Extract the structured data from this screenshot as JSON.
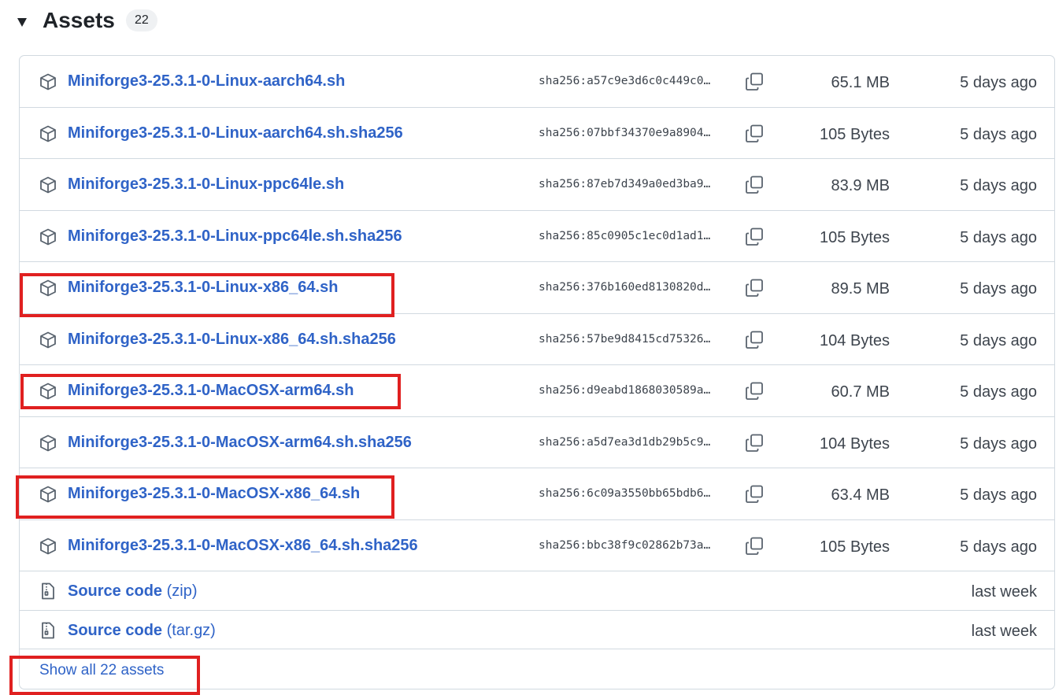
{
  "header": {
    "title": "Assets",
    "count": "22"
  },
  "assets": [
    {
      "name": "Miniforge3-25.3.1-0-Linux-aarch64.sh",
      "sha": "sha256:a57c9e3d6c0c449c0…",
      "size": "65.1 MB",
      "date": "5 days ago"
    },
    {
      "name": "Miniforge3-25.3.1-0-Linux-aarch64.sh.sha256",
      "sha": "sha256:07bbf34370e9a8904…",
      "size": "105 Bytes",
      "date": "5 days ago"
    },
    {
      "name": "Miniforge3-25.3.1-0-Linux-ppc64le.sh",
      "sha": "sha256:87eb7d349a0ed3ba9…",
      "size": "83.9 MB",
      "date": "5 days ago"
    },
    {
      "name": "Miniforge3-25.3.1-0-Linux-ppc64le.sh.sha256",
      "sha": "sha256:85c0905c1ec0d1ad1…",
      "size": "105 Bytes",
      "date": "5 days ago"
    },
    {
      "name": "Miniforge3-25.3.1-0-Linux-x86_64.sh",
      "sha": "sha256:376b160ed8130820d…",
      "size": "89.5 MB",
      "date": "5 days ago"
    },
    {
      "name": "Miniforge3-25.3.1-0-Linux-x86_64.sh.sha256",
      "sha": "sha256:57be9d8415cd75326…",
      "size": "104 Bytes",
      "date": "5 days ago"
    },
    {
      "name": "Miniforge3-25.3.1-0-MacOSX-arm64.sh",
      "sha": "sha256:d9eabd1868030589a…",
      "size": "60.7 MB",
      "date": "5 days ago"
    },
    {
      "name": "Miniforge3-25.3.1-0-MacOSX-arm64.sh.sha256",
      "sha": "sha256:a5d7ea3d1db29b5c9…",
      "size": "104 Bytes",
      "date": "5 days ago"
    },
    {
      "name": "Miniforge3-25.3.1-0-MacOSX-x86_64.sh",
      "sha": "sha256:6c09a3550bb65bdb6…",
      "size": "63.4 MB",
      "date": "5 days ago"
    },
    {
      "name": "Miniforge3-25.3.1-0-MacOSX-x86_64.sh.sha256",
      "sha": "sha256:bbc38f9c02862b73a…",
      "size": "105 Bytes",
      "date": "5 days ago"
    }
  ],
  "source": [
    {
      "label": "Source code",
      "ext": "(zip)",
      "date": "last week"
    },
    {
      "label": "Source code",
      "ext": "(tar.gz)",
      "date": "last week"
    }
  ],
  "footer": {
    "show_all": "Show all 22 assets"
  },
  "icons": {
    "asset": "package-icon",
    "source": "file-zip-icon",
    "copy": "copy-icon"
  },
  "colors": {
    "link": "#2f63c7",
    "highlight": "#e02020",
    "border": "#d1d9e0"
  }
}
